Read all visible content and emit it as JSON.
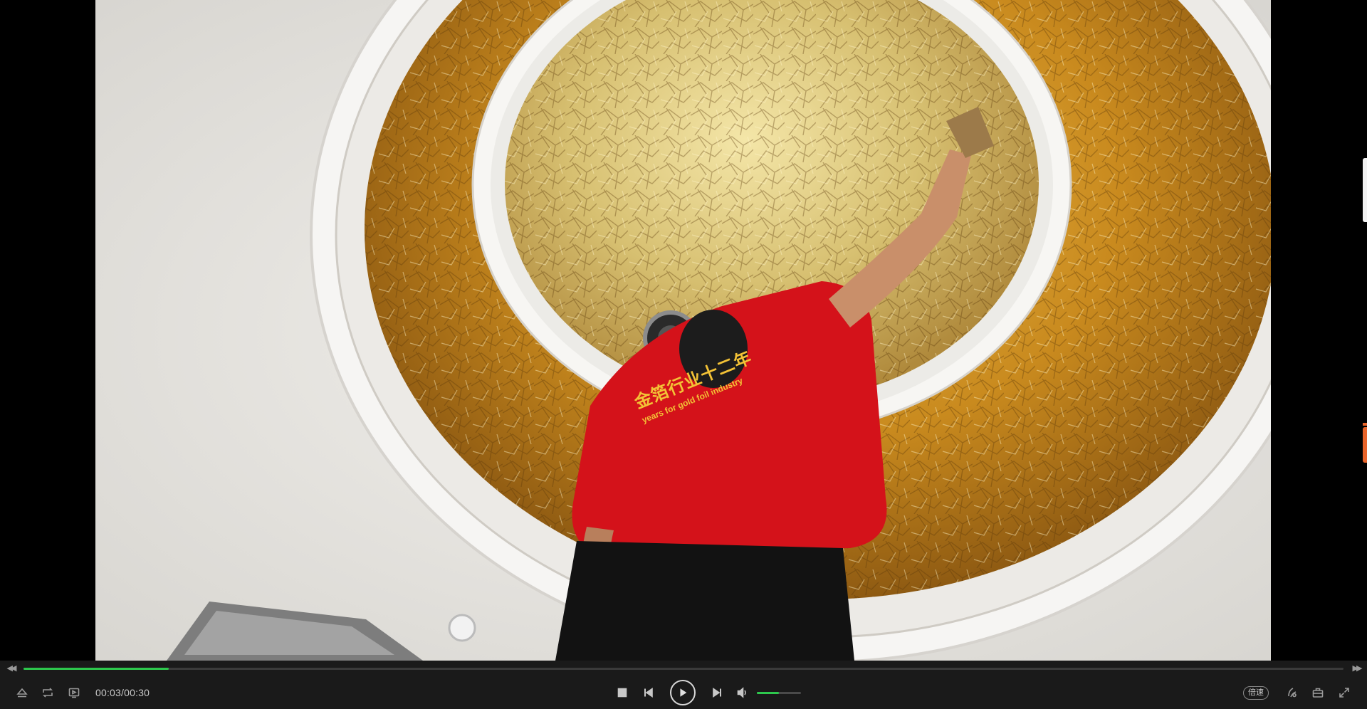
{
  "player": {
    "time_display": "00:03/00:30",
    "progress_fraction": 0.11,
    "volume_fraction": 0.5,
    "speed_label": "倍速"
  },
  "video": {
    "shirt_text_line1": "金箔行业十二年",
    "shirt_text_line2": "years for gold foil industry"
  },
  "colors": {
    "bar_background": "#1a1a1a",
    "progress_accent": "#2dc84d",
    "side_tab_accent": "#e8642a",
    "icon_gray": "#9a9a9a"
  },
  "icons": {
    "seek_back": "double-chevron-left-icon",
    "seek_forward": "double-chevron-right-icon",
    "eject": "eject-icon",
    "loop": "loop-icon",
    "playlist": "playlist-icon",
    "stop": "stop-icon",
    "previous": "skip-previous-icon",
    "play": "play-icon",
    "next": "skip-next-icon",
    "volume": "volume-icon",
    "pip": "pip-icon",
    "toolbox": "toolbox-icon",
    "fullscreen": "fullscreen-icon"
  }
}
